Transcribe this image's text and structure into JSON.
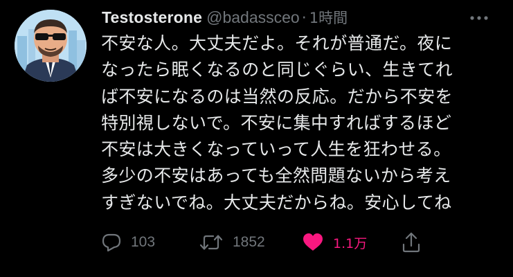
{
  "tweet": {
    "author": {
      "display_name": "Testosterone",
      "handle": "@badassceo"
    },
    "separator": "·",
    "timestamp": "1時間",
    "text_lines": [
      "不安な人。大丈夫だよ。それが普通だ。夜に",
      "なったら眠くなるのと同じぐらい、生きてれ",
      "ば不安になるのは当然の反応。だから不安を",
      "特別視しないで。不安に集中すればするほど",
      "不安は大きくなっていって人生を狂わせる。",
      "多少の不安はあっても全然問題ないから考え",
      "すぎないでね。大丈夫だからね。安心してね"
    ],
    "actions": {
      "reply_count": "103",
      "retweet_count": "1852",
      "like_count": "1.1万"
    },
    "icons": {
      "more": "more-horizontal-icon",
      "reply": "reply-bubble-icon",
      "retweet": "retweet-icon",
      "like": "heart-filled-icon",
      "share": "share-upload-icon"
    }
  },
  "colors": {
    "background": "#000000",
    "primary_text": "#e7e9ea",
    "secondary_text": "#71767b",
    "like_active": "#f91880"
  }
}
